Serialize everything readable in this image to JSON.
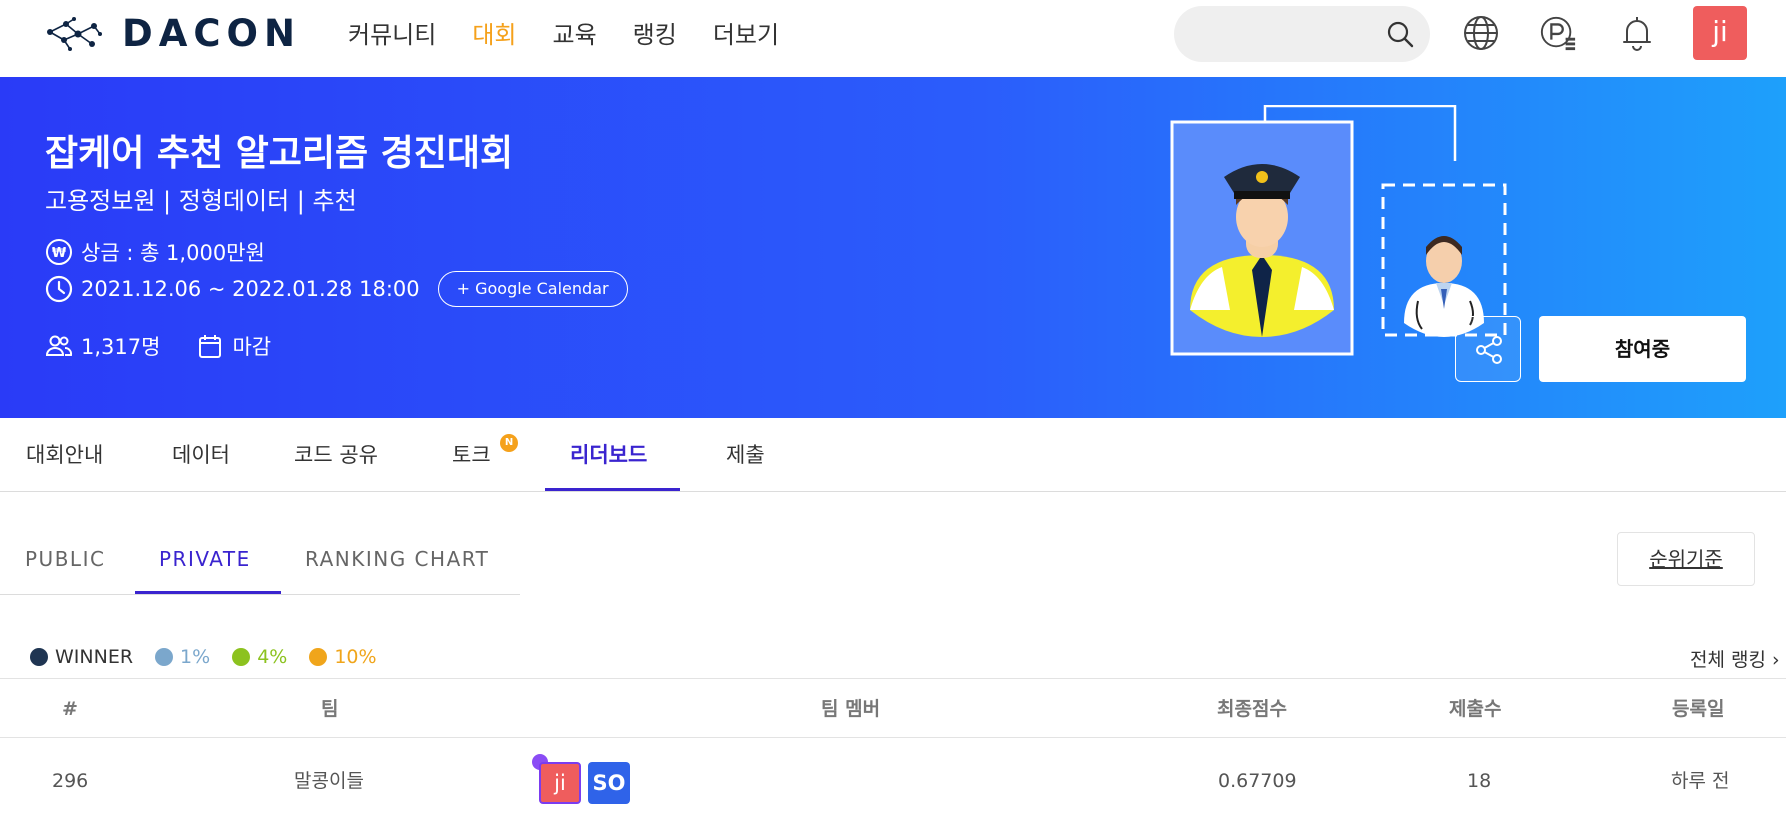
{
  "nav": {
    "logo_text": "DACON",
    "menu": [
      "커뮤니티",
      "대회",
      "교육",
      "랭킹",
      "더보기"
    ],
    "active_menu": "대회",
    "user_avatar": "ji",
    "icons": [
      "search-icon",
      "globe-icon",
      "point-icon",
      "bell-icon"
    ]
  },
  "banner": {
    "title": "잡케어 추천 알고리즘 경진대회",
    "subtitle": "고용정보원 | 정형데이터 | 추천",
    "prize": "상금 : 총 1,000만원",
    "period": "2021.12.06 ~ 2022.01.28 18:00",
    "calendar_button": "+ Google Calendar",
    "participants": "1,317명",
    "status": "마감",
    "join_button": "참여중"
  },
  "tabs": {
    "items": [
      "대회안내",
      "데이터",
      "코드 공유",
      "토크",
      "리더보드",
      "제출"
    ],
    "active": "리더보드",
    "new_badge": "N"
  },
  "subtabs": {
    "items": [
      "PUBLIC",
      "PRIVATE",
      "RANKING CHART"
    ],
    "active": "PRIVATE",
    "rank_basis": "순위기준"
  },
  "legend": {
    "items": [
      {
        "label": "WINNER",
        "color": "#1f3552"
      },
      {
        "label": "1%",
        "color": "#7ba7cc"
      },
      {
        "label": "4%",
        "color": "#8cc21f"
      },
      {
        "label": "10%",
        "color": "#f0a51b"
      }
    ],
    "full_ranking": "전체 랭킹"
  },
  "table": {
    "headers": [
      "#",
      "팀",
      "팀 멤버",
      "최종점수",
      "제출수",
      "등록일"
    ],
    "rows": [
      {
        "rank": "296",
        "team": "말콩이들",
        "members": [
          "ji",
          "SO"
        ],
        "score": "0.67709",
        "submissions": "18",
        "registered": "하루 전"
      }
    ]
  },
  "colors": {
    "accent": "#3a24cf",
    "active_menu": "#f5a11b",
    "banner_start": "#2a3bf7",
    "banner_end": "#1ea0fb"
  }
}
